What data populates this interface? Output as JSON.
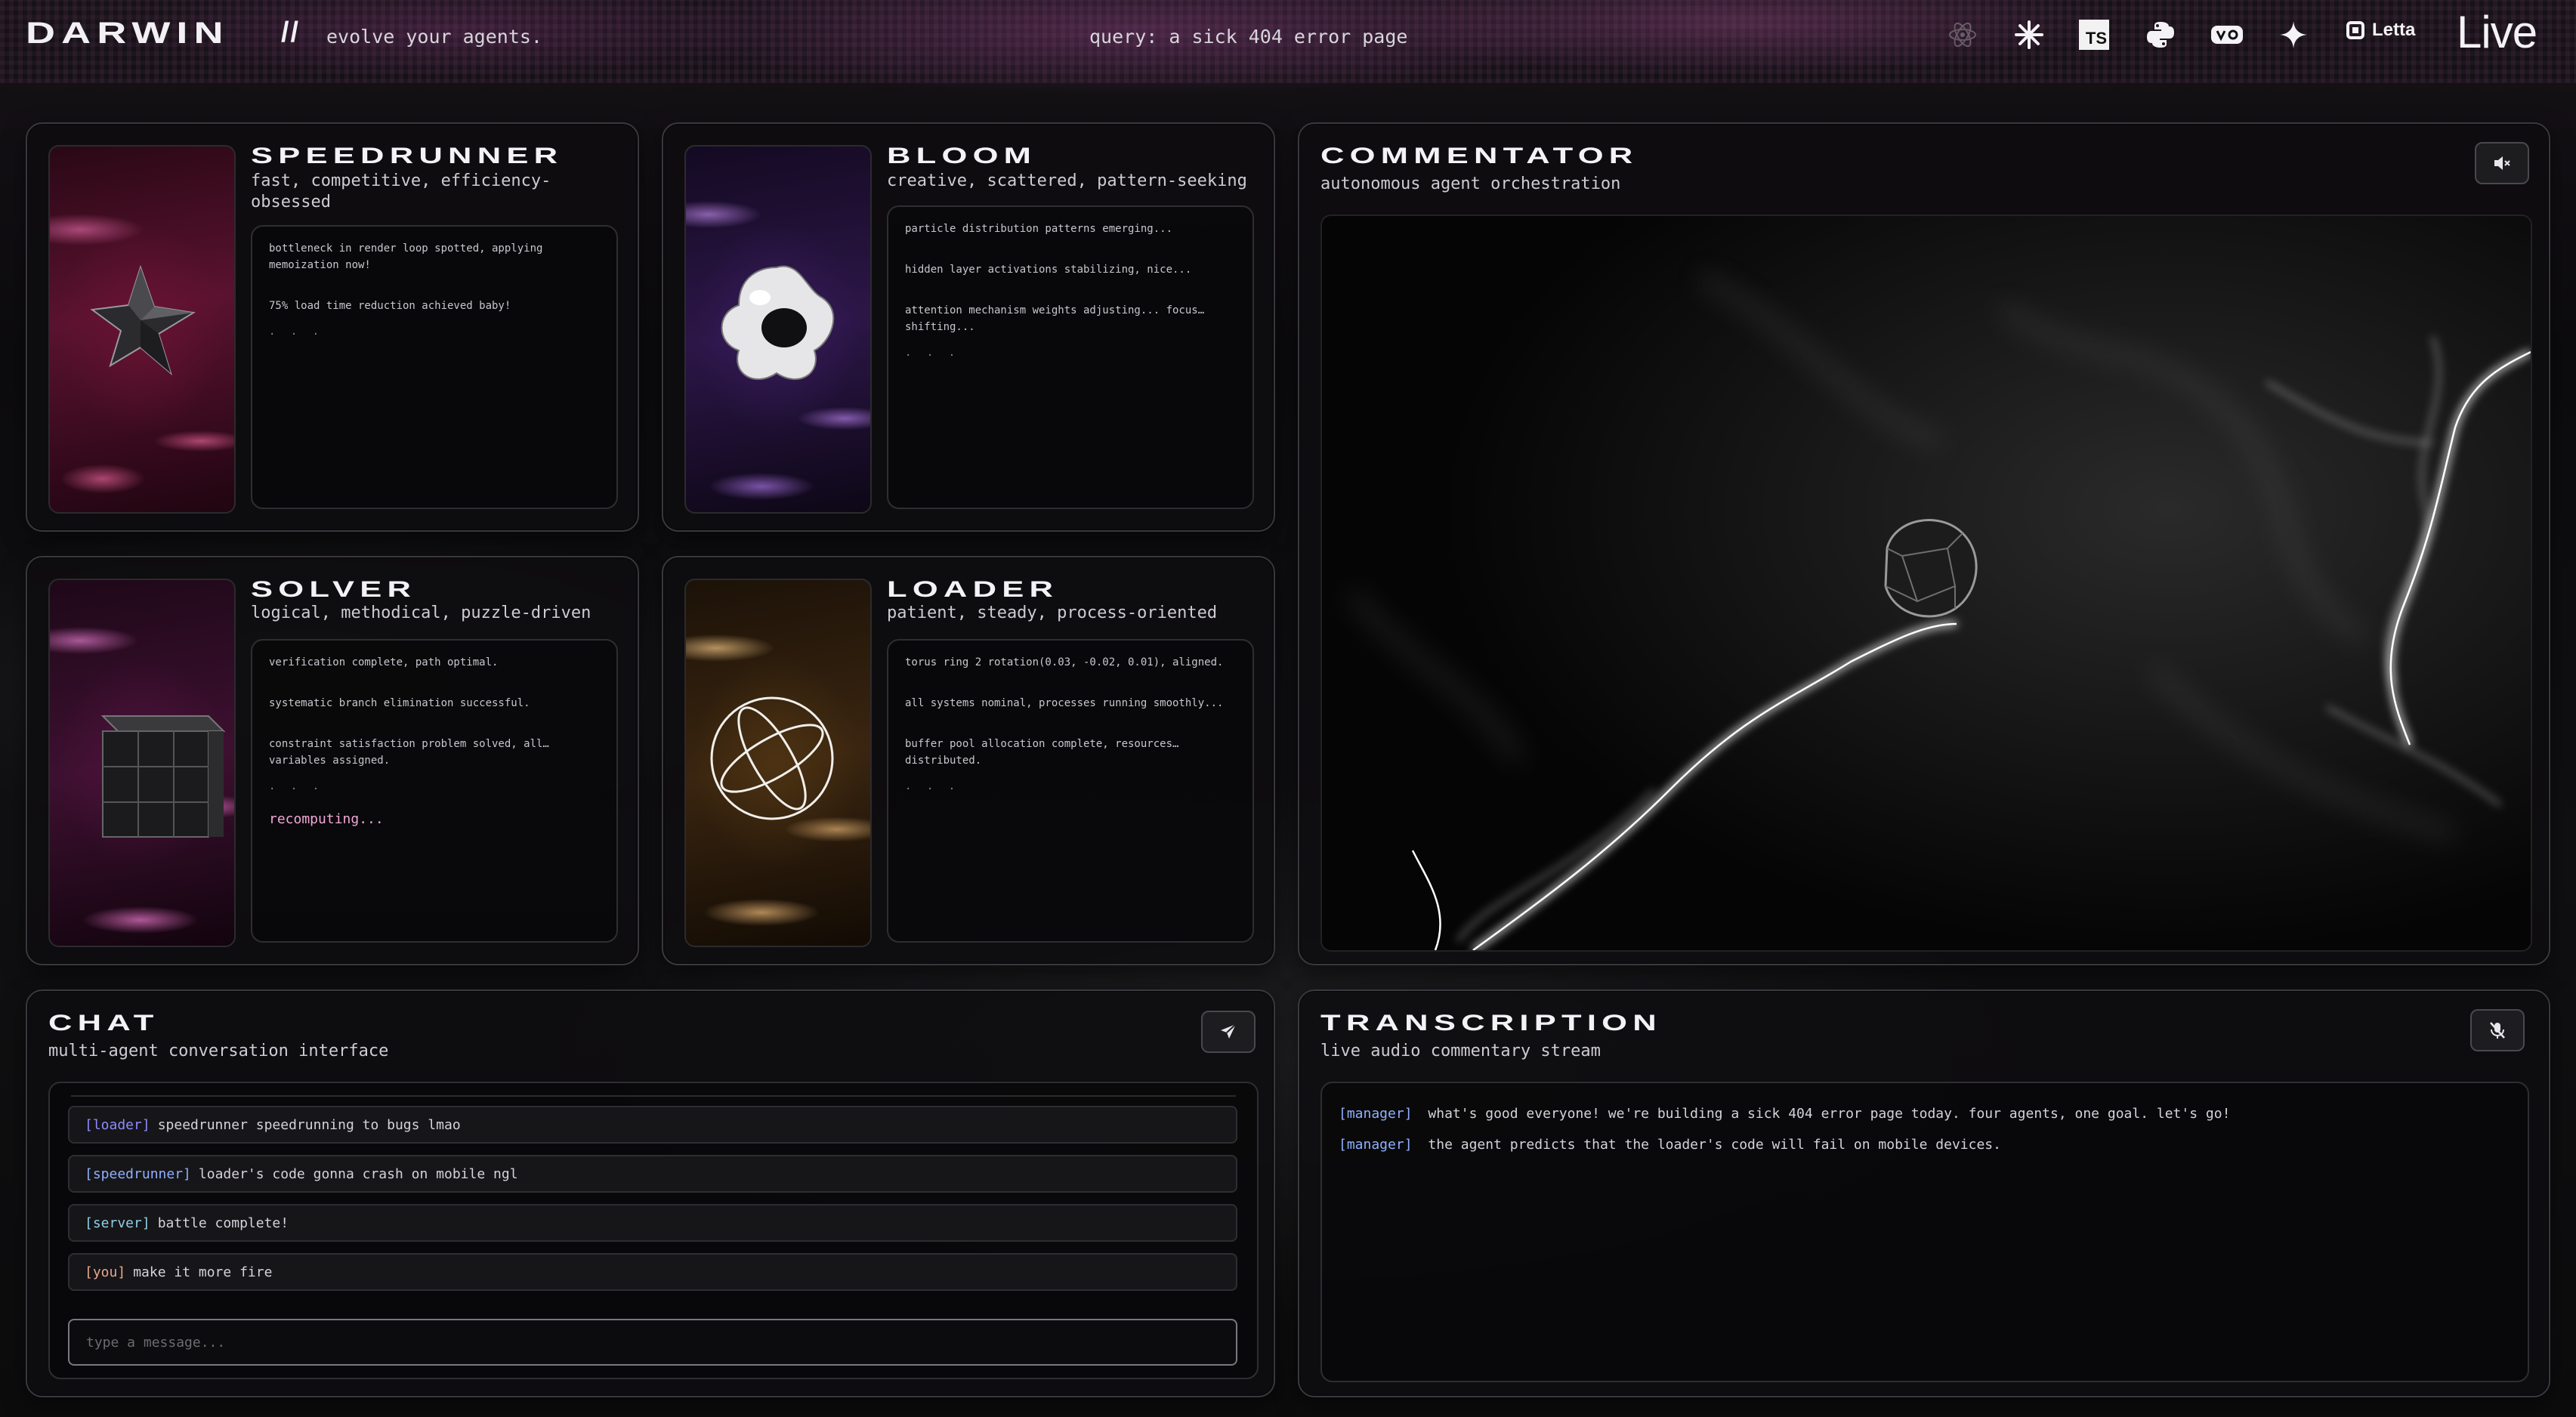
{
  "header": {
    "logo": "DARWIN",
    "slashes": "//",
    "tagline": "evolve your agents.",
    "query": "query: a sick 404 error page",
    "icons": [
      "react-icon",
      "claude-icon",
      "typescript-icon",
      "python-icon",
      "vercel-v0-icon",
      "gemini-icon",
      "letta-icon",
      "livekit-icon"
    ],
    "ts_label": "TS",
    "letta_label": "Letta",
    "live_label": "Live"
  },
  "agents": [
    {
      "title": "SPEEDRUNNER",
      "subtitle": "fast, competitive, efficiency-obsessed",
      "logs": [
        "bottleneck in render loop spotted, applying memoization now!",
        "75% load time reduction achieved baby!"
      ],
      "dots": ". . .",
      "status": ""
    },
    {
      "title": "BLOOM",
      "subtitle": "creative, scattered, pattern-seeking",
      "logs": [
        "particle distribution patterns emerging...",
        "hidden layer activations stabilizing, nice...",
        "attention mechanism weights adjusting... focus… shifting..."
      ],
      "dots": ". . .",
      "status": ""
    },
    {
      "title": "SOLVER",
      "subtitle": "logical, methodical, puzzle-driven",
      "logs": [
        "verification complete, path optimal.",
        "systematic branch elimination successful.",
        "constraint satisfaction problem solved, all… variables assigned."
      ],
      "dots": ". . .",
      "status": "recomputing..."
    },
    {
      "title": "LOADER",
      "subtitle": "patient, steady, process-oriented",
      "logs": [
        "torus ring 2 rotation(0.03, -0.02, 0.01), aligned.",
        "all systems nominal, processes running smoothly...",
        "buffer pool allocation complete, resources… distributed."
      ],
      "dots": ". . .",
      "status": ""
    }
  ],
  "commentator": {
    "title": "COMMENTATOR",
    "subtitle": "autonomous agent orchestration",
    "mute_icon": "speaker-muted-icon"
  },
  "chat": {
    "title": "CHAT",
    "subtitle": "multi-agent conversation interface",
    "send_icon": "send-icon",
    "messages": [
      {
        "tag": "[loader]",
        "text": "speedrunner speedrunning to bugs lmao",
        "color": "#8f8bff"
      },
      {
        "tag": "[speedrunner]",
        "text": "loader's code gonna crash on mobile ngl",
        "color": "#8fb0ff"
      },
      {
        "tag": "[server]",
        "text": "battle complete!",
        "color": "#8fd0e6"
      },
      {
        "tag": "[you]",
        "text": "make it more fire",
        "color": "#e6a88f"
      }
    ],
    "placeholder": "type a message..."
  },
  "transcription": {
    "title": "TRANSCRIPTION",
    "subtitle": "live audio commentary stream",
    "mic_icon": "mic-off-icon",
    "lines": [
      {
        "tag": "[manager]",
        "text": "what's good everyone! we're building a sick 404 error page today. four agents, one goal. let's go!"
      },
      {
        "tag": "[manager]",
        "text": "the agent predicts that the loader's code will fail on mobile devices."
      }
    ]
  }
}
